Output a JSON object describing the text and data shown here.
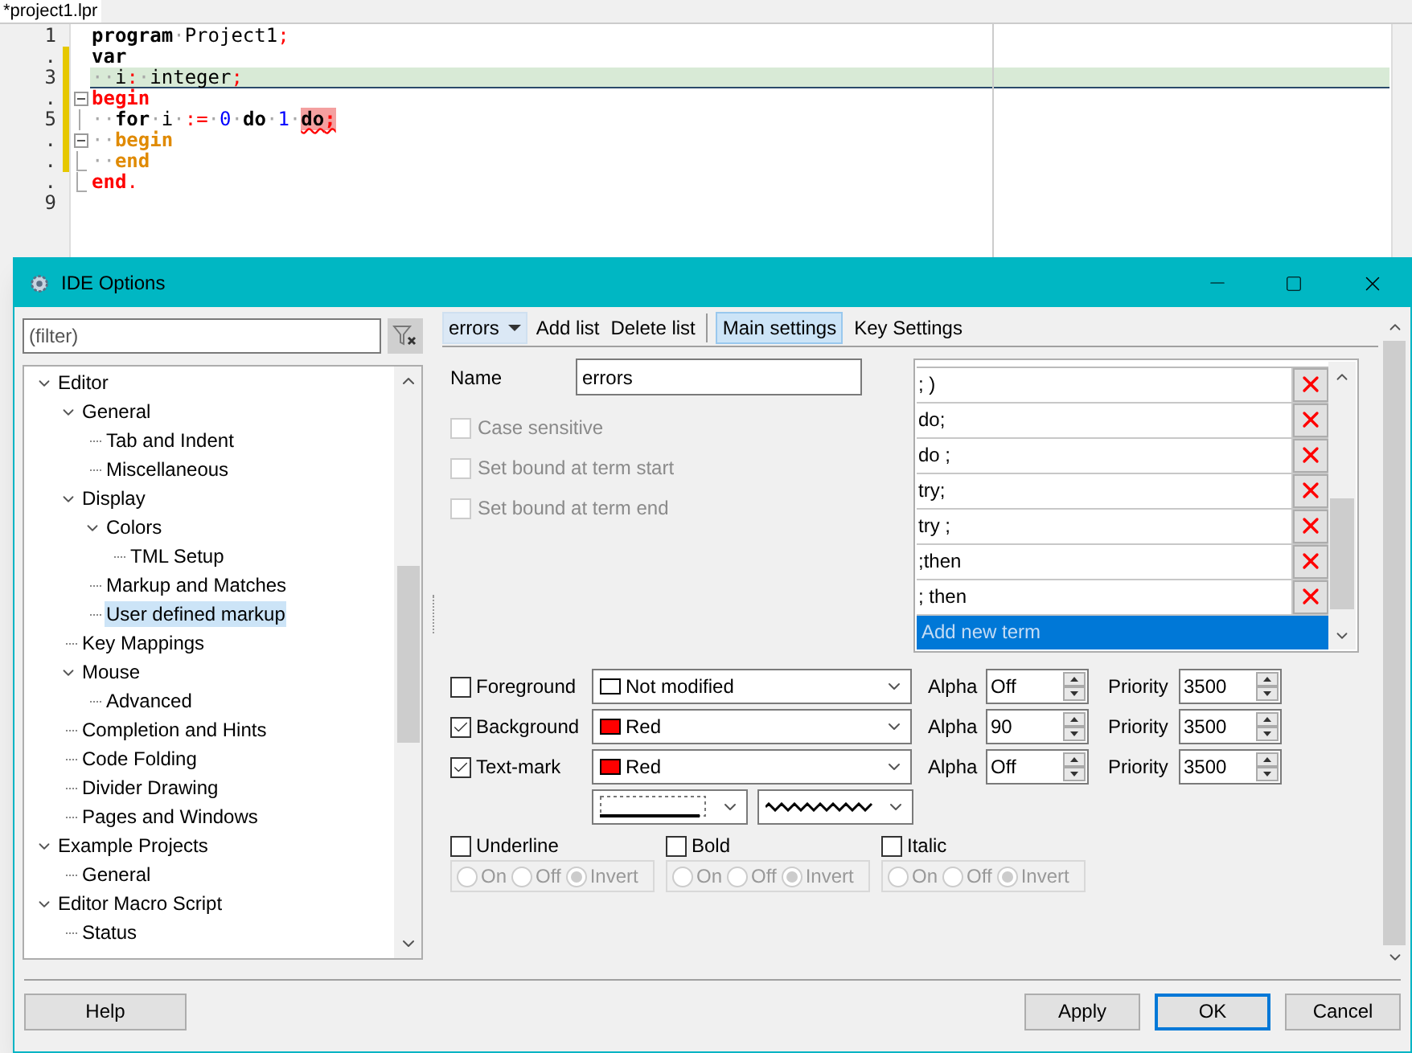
{
  "editor": {
    "tab": {
      "label": "*project1.lpr",
      "selected": true
    },
    "lines": [
      {
        "number": "1",
        "modified": false,
        "current": false,
        "tokens": [
          {
            "text": "program",
            "kind": "kw"
          },
          {
            "text": "·",
            "kind": "ws"
          },
          {
            "text": "Project1",
            "kind": "id"
          },
          {
            "text": ";",
            "kind": "sym"
          }
        ]
      },
      {
        "number": ".",
        "modified": true,
        "current": false,
        "tokens": [
          {
            "text": "var",
            "kind": "kw"
          }
        ]
      },
      {
        "number": "3",
        "modified": true,
        "current": true,
        "tokens": [
          {
            "text": "··",
            "kind": "ws"
          },
          {
            "text": "i",
            "kind": "id"
          },
          {
            "text": ":",
            "kind": "sym"
          },
          {
            "text": "·",
            "kind": "ws"
          },
          {
            "text": "integer",
            "kind": "id"
          },
          {
            "text": ";",
            "kind": "sym"
          }
        ]
      },
      {
        "number": ".",
        "modified": true,
        "current": false,
        "expanded": true,
        "tokens": [
          {
            "text": "begin",
            "kind": "blk"
          }
        ]
      },
      {
        "number": "5",
        "modified": true,
        "current": false,
        "tokens": [
          {
            "text": "··",
            "kind": "ws"
          },
          {
            "text": "for",
            "kind": "kw"
          },
          {
            "text": "·",
            "kind": "ws"
          },
          {
            "text": "i",
            "kind": "id"
          },
          {
            "text": "·",
            "kind": "ws"
          },
          {
            "text": ":=",
            "kind": "sym"
          },
          {
            "text": "·",
            "kind": "ws"
          },
          {
            "text": "0",
            "kind": "num"
          },
          {
            "text": "·",
            "kind": "ws"
          },
          {
            "text": "do",
            "kind": "kw"
          },
          {
            "text": "·",
            "kind": "ws"
          },
          {
            "text": "1",
            "kind": "num"
          },
          {
            "text": "·",
            "kind": "ws"
          },
          {
            "text": "do",
            "kind": "err"
          },
          {
            "text": ";",
            "kind": "errsym"
          }
        ]
      },
      {
        "number": ".",
        "modified": true,
        "current": false,
        "expanded": true,
        "tokens": [
          {
            "text": "··",
            "kind": "ws"
          },
          {
            "text": "begin",
            "kind": "nest"
          }
        ]
      },
      {
        "number": ".",
        "modified": true,
        "current": false,
        "fold_end": true,
        "tokens": [
          {
            "text": "··",
            "kind": "ws"
          },
          {
            "text": "end",
            "kind": "nest"
          }
        ]
      },
      {
        "number": ".",
        "modified": false,
        "current": false,
        "fold_end": true,
        "tokens": [
          {
            "text": "end",
            "kind": "blk"
          },
          {
            "text": ".",
            "kind": "sym"
          }
        ]
      },
      {
        "number": "9",
        "modified": false,
        "current": false
      }
    ]
  },
  "dialog": {
    "title": "IDE Options",
    "filter": {
      "placeholder": "(filter)"
    },
    "tree": [
      {
        "label": "Editor",
        "expanded": true,
        "selected": false,
        "children": [
          {
            "label": "General",
            "expanded": true,
            "selected": false,
            "children": [
              {
                "label": "Tab and Indent",
                "selected": false
              },
              {
                "label": "Miscellaneous",
                "selected": false
              }
            ]
          },
          {
            "label": "Display",
            "expanded": true,
            "selected": false,
            "children": [
              {
                "label": "Colors",
                "expanded": true,
                "selected": false,
                "children": [
                  {
                    "label": "TML Setup",
                    "selected": false
                  }
                ]
              },
              {
                "label": "Markup and Matches",
                "selected": false
              },
              {
                "label": "User defined markup",
                "selected": true
              }
            ]
          },
          {
            "label": "Key Mappings",
            "selected": false
          },
          {
            "label": "Mouse",
            "expanded": true,
            "selected": false,
            "children": [
              {
                "label": "Advanced",
                "selected": false
              }
            ]
          },
          {
            "label": "Completion and Hints",
            "selected": false
          },
          {
            "label": "Code Folding",
            "selected": false
          },
          {
            "label": "Divider Drawing",
            "selected": false
          },
          {
            "label": "Pages and Windows",
            "selected": false
          }
        ]
      },
      {
        "label": "Example Projects",
        "expanded": true,
        "selected": false,
        "children": [
          {
            "label": "General",
            "selected": false
          }
        ]
      },
      {
        "label": "Editor Macro Script",
        "expanded": true,
        "selected": false,
        "children": [
          {
            "label": "Status",
            "selected": false
          }
        ]
      }
    ],
    "toolbar": {
      "list": "errors",
      "actions": [
        "Add list",
        "Delete list"
      ],
      "tabs": [
        {
          "label": "Main settings",
          "selected": true
        },
        {
          "label": "Key Settings",
          "selected": false
        }
      ]
    },
    "name": {
      "label": "Name",
      "value": "errors"
    },
    "options": [
      {
        "label": "Case sensitive",
        "checked": false,
        "disabled": true
      },
      {
        "label": "Set bound at term start",
        "checked": false,
        "disabled": true
      },
      {
        "label": "Set bound at term end",
        "checked": false,
        "disabled": true
      }
    ],
    "terms": [
      "; )",
      "do;",
      "do ;",
      "try;",
      "try ;",
      ";then",
      "; then"
    ],
    "new_term": {
      "placeholder": "Add new term",
      "selected": true
    },
    "attributes": [
      {
        "label": "Foreground",
        "checked": false,
        "color": "#ffffff",
        "color_name": "Not modified",
        "alpha_label": "Alpha",
        "alpha": "Off",
        "priority_label": "Priority",
        "priority": "3500"
      },
      {
        "label": "Background",
        "checked": true,
        "color": "#ff0000",
        "color_name": "Red",
        "alpha_label": "Alpha",
        "alpha": "90",
        "priority_label": "Priority",
        "priority": "3500"
      },
      {
        "label": "Text-mark",
        "checked": true,
        "color": "#ff0000",
        "color_name": "Red",
        "alpha_label": "Alpha",
        "alpha": "Off",
        "priority_label": "Priority",
        "priority": "3500"
      }
    ],
    "line_styles": [
      {
        "kind": "frame"
      },
      {
        "kind": "wave"
      }
    ],
    "styles": [
      {
        "label": "Underline",
        "checked": false,
        "disabled": true,
        "options": [
          {
            "label": "On",
            "selected": false
          },
          {
            "label": "Off",
            "selected": false
          },
          {
            "label": "Invert",
            "selected": true
          }
        ]
      },
      {
        "label": "Bold",
        "checked": false,
        "disabled": true,
        "options": [
          {
            "label": "On",
            "selected": false
          },
          {
            "label": "Off",
            "selected": false
          },
          {
            "label": "Invert",
            "selected": true
          }
        ]
      },
      {
        "label": "Italic",
        "checked": false,
        "disabled": true,
        "options": [
          {
            "label": "On",
            "selected": false
          },
          {
            "label": "Off",
            "selected": false
          },
          {
            "label": "Invert",
            "selected": true
          }
        ]
      }
    ],
    "buttons": {
      "help": "Help",
      "actions": [
        {
          "label": "Apply",
          "default": false
        },
        {
          "label": "OK",
          "default": true
        },
        {
          "label": "Cancel",
          "default": false
        }
      ]
    }
  }
}
